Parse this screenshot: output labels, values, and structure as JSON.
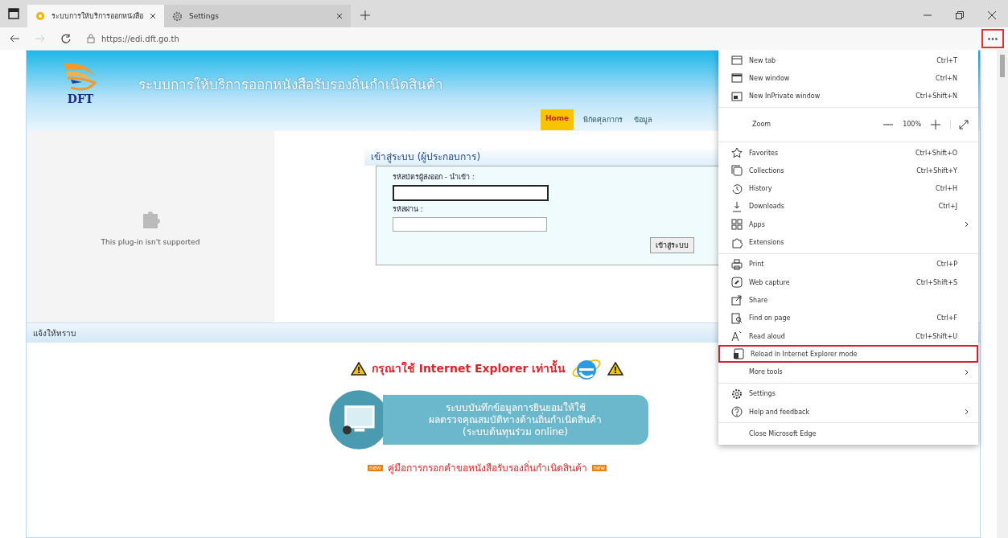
{
  "tabs": [
    {
      "title": "ระบบการให้บริการออกหนังสือ",
      "selected": true
    },
    {
      "title": "Settings",
      "selected": false
    }
  ],
  "address": "https://edi.dft.go.th",
  "site": {
    "logo": "DFT",
    "title": "ระบบการให้บริการออกหนังสือรับรองถิ่นกำเนิดสินค้า",
    "nav": [
      {
        "label": "Home",
        "selected": true
      },
      {
        "label": "พิกัดศุลกากร",
        "selected": false
      },
      {
        "label": "ข้อมูล",
        "selected": false
      }
    ],
    "plugin_message": "This plug-in isn't supported",
    "login": {
      "title": "เข้าสู่ระบบ (ผู้ประกอบการ)",
      "fields": [
        {
          "label": "รหัสบัตรผู้ส่งออก - นำเข้า :",
          "focused": true
        },
        {
          "label": "รหัสผ่าน :",
          "focused": false
        }
      ],
      "button": "เข้าสู่ระบบ"
    },
    "notice_title": "แจ้งให้ทราบ",
    "warning": "กรุณาใช้ Internet Explorer เท่านั้น",
    "banner": [
      "ระบบบันทึกข้อมูลการยินยอมให้ใช้",
      "ผลตรวจคุณสมบัติทางด้านถิ่นกำเนิดสินค้า",
      "(ระบบต้นทุนร่วม online)"
    ],
    "manual": {
      "badge_left": "new",
      "text": "คู่มือการกรอกคำขอหนังสือรับรองถิ่นกำเนิดสินค้า",
      "badge_right": "new"
    }
  },
  "menu": {
    "groups": [
      [
        {
          "kind": "item",
          "label": "New tab",
          "shortcut": "Ctrl+T"
        },
        {
          "kind": "item",
          "label": "New window",
          "shortcut": "Ctrl+N"
        },
        {
          "kind": "item",
          "label": "New InPrivate window",
          "shortcut": "Ctrl+Shift+N"
        }
      ],
      [
        {
          "kind": "zoom",
          "label": "Zoom",
          "value": "100%"
        }
      ],
      [
        {
          "kind": "item",
          "label": "Favorites",
          "shortcut": "Ctrl+Shift+O"
        },
        {
          "kind": "item",
          "label": "Collections",
          "shortcut": "Ctrl+Shift+Y"
        },
        {
          "kind": "item",
          "label": "History",
          "shortcut": "Ctrl+H"
        },
        {
          "kind": "item",
          "label": "Downloads",
          "shortcut": "Ctrl+J"
        },
        {
          "kind": "item",
          "label": "Apps",
          "submenu": true
        },
        {
          "kind": "item",
          "label": "Extensions"
        }
      ],
      [
        {
          "kind": "item",
          "label": "Print",
          "shortcut": "Ctrl+P"
        },
        {
          "kind": "item",
          "label": "Web capture",
          "shortcut": "Ctrl+Shift+S"
        },
        {
          "kind": "item",
          "label": "Share"
        },
        {
          "kind": "item",
          "label": "Find on page",
          "shortcut": "Ctrl+F"
        },
        {
          "kind": "item",
          "label": "Read aloud",
          "shortcut": "Ctrl+Shift+U"
        },
        {
          "kind": "item",
          "label": "Reload in Internet Explorer mode",
          "highlighted": true
        },
        {
          "kind": "item",
          "label": "More tools",
          "submenu": true
        }
      ],
      [
        {
          "kind": "item",
          "label": "Settings"
        },
        {
          "kind": "item",
          "label": "Help and feedback",
          "submenu": true
        }
      ],
      [
        {
          "kind": "item",
          "label": "Close Microsoft Edge"
        }
      ]
    ]
  }
}
